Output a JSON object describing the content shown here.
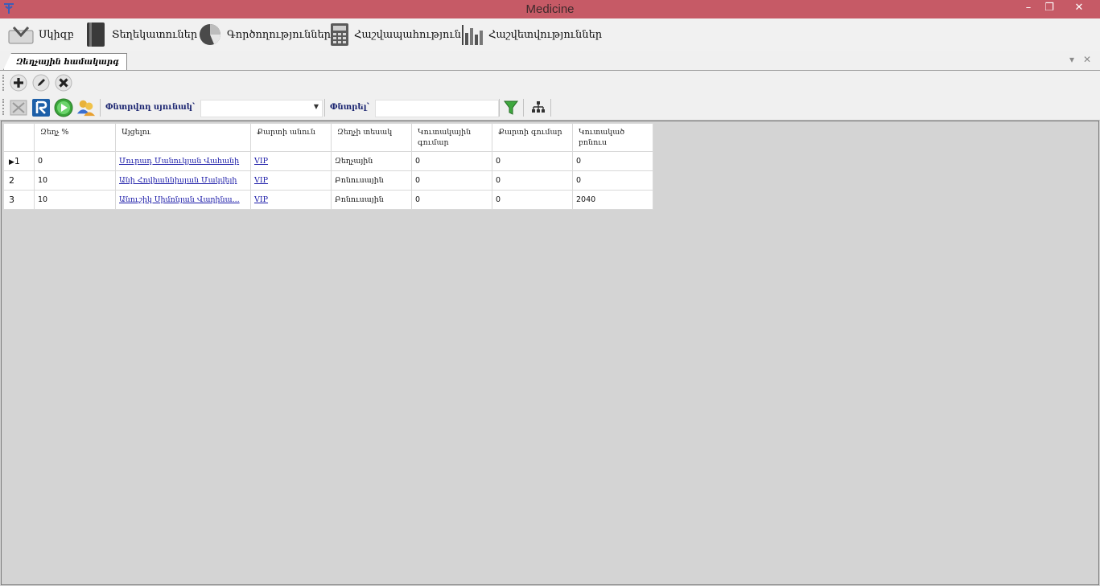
{
  "window": {
    "title": "Medicine",
    "controls": {
      "minimize": "–",
      "restore": "❐",
      "close": "✕"
    }
  },
  "menu": [
    {
      "label": "Սկիզբ",
      "icon": "start-icon"
    },
    {
      "label": "Տեղեկատուներ",
      "icon": "book-icon"
    },
    {
      "label": "Գործողություններ",
      "icon": "pie-chart-icon"
    },
    {
      "label": "Հաշվապահություն",
      "icon": "calculator-icon"
    },
    {
      "label": "Հաշվետվություններ",
      "icon": "bar-chart-icon"
    }
  ],
  "tab": {
    "label": "Զեղչային համակարգ"
  },
  "toolbar": {
    "search_column_label": "Փնտրվող սյունակ՝",
    "search_column_value": "",
    "search_label": "Փնտրել՝",
    "search_value": ""
  },
  "table": {
    "headers": [
      "Զեղչ %",
      "Այցելու",
      "Քարտի անուն",
      "Զեղչի տեսակ",
      "Կուտակային գումար",
      "Քարտի գումար",
      "Կուտակած բոնուս"
    ],
    "rows": [
      {
        "num": "1",
        "discount": "0",
        "visitor": "Մուրադ Մանուկյան Վահանի",
        "card_name": "VIP",
        "type": "Զեղչային",
        "accum_sum": "0",
        "card_sum": "0",
        "bonus": "0"
      },
      {
        "num": "2",
        "discount": "10",
        "visitor": "Անի Հովհաննիսյան Մակվելի",
        "card_name": "VIP",
        "type": "Բոնուսային",
        "accum_sum": "0",
        "card_sum": "0",
        "bonus": "0"
      },
      {
        "num": "3",
        "discount": "10",
        "visitor": "Անուշիկ Սիմոնյան Վաղինա...",
        "card_name": "VIP",
        "type": "Բոնուսային",
        "accum_sum": "0",
        "card_sum": "0",
        "bonus": "2040"
      }
    ]
  },
  "colors": {
    "titlebar": "#c65a66",
    "link": "#1a1aa8",
    "accent_label": "#1a2470"
  }
}
